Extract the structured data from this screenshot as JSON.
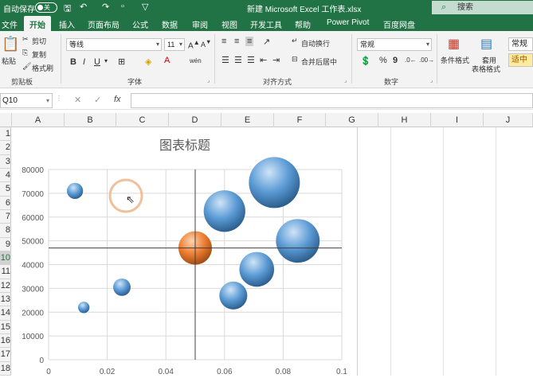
{
  "titlebar": {
    "autosave_label": "自动保存",
    "autosave_state": "关",
    "doc_title": "新建 Microsoft Excel 工作表.xlsx",
    "search_placeholder": "搜索"
  },
  "tabs": [
    "文件",
    "开始",
    "插入",
    "页面布局",
    "公式",
    "数据",
    "审阅",
    "视图",
    "开发工具",
    "帮助",
    "Power Pivot",
    "百度网盘"
  ],
  "ribbon": {
    "clipboard": {
      "paste": "粘贴",
      "cut": "剪切",
      "copy": "复制",
      "format_painter": "格式刷",
      "label": "剪贴板"
    },
    "font": {
      "name": "等线",
      "size": "11",
      "bold": "B",
      "italic": "I",
      "underline": "U",
      "label": "字体"
    },
    "alignment": {
      "wrap": "自动换行",
      "merge": "合并后居中",
      "label": "对齐方式"
    },
    "number": {
      "format": "常规",
      "percent": "%",
      "comma": "9",
      "label": "数字"
    },
    "styles": {
      "conditional": "条件格式",
      "table_format_1": "套用",
      "table_format_2": "表格格式",
      "normal": "常规",
      "neutral": "适中"
    }
  },
  "formula_bar": {
    "name_box": "Q10",
    "fx": "fx",
    "cancel": "✕",
    "enter": "✓",
    "value": ""
  },
  "columns": [
    "A",
    "B",
    "C",
    "D",
    "E",
    "F",
    "G",
    "H",
    "I",
    "J"
  ],
  "rows": [
    "1",
    "2",
    "3",
    "4",
    "5",
    "6",
    "7",
    "8",
    "9",
    "10",
    "11",
    "12",
    "13",
    "14",
    "15",
    "16",
    "17",
    "18"
  ],
  "selected_row": "10",
  "chart_data": {
    "type": "scatter",
    "subtype": "bubble",
    "title": "图表标题",
    "xlim": [
      0,
      0.1
    ],
    "ylim": [
      0,
      80000
    ],
    "xticks": [
      "0",
      "0.02",
      "0.04",
      "0.06",
      "0.08",
      "0.1"
    ],
    "yticks": [
      "0",
      "10000",
      "20000",
      "30000",
      "40000",
      "50000",
      "60000",
      "70000",
      "80000"
    ],
    "crosshair": {
      "x": 0.05,
      "y": 47000
    },
    "grid": true,
    "points": [
      {
        "x": 0.009,
        "y": 71000,
        "size": 3,
        "color": "#5b9bd5"
      },
      {
        "x": 0.012,
        "y": 22000,
        "size": 1.5,
        "color": "#5b9bd5"
      },
      {
        "x": 0.025,
        "y": 30500,
        "size": 3.5,
        "color": "#5b9bd5"
      },
      {
        "x": 0.05,
        "y": 47000,
        "size": 13,
        "color": "#ed7d31"
      },
      {
        "x": 0.06,
        "y": 62500,
        "size": 20,
        "color": "#5b9bd5"
      },
      {
        "x": 0.063,
        "y": 27000,
        "size": 9,
        "color": "#5b9bd5"
      },
      {
        "x": 0.071,
        "y": 38000,
        "size": 14,
        "color": "#5b9bd5"
      },
      {
        "x": 0.077,
        "y": 74500,
        "size": 30,
        "color": "#5b9bd5"
      },
      {
        "x": 0.085,
        "y": 50000,
        "size": 22,
        "color": "#5b9bd5"
      }
    ]
  }
}
